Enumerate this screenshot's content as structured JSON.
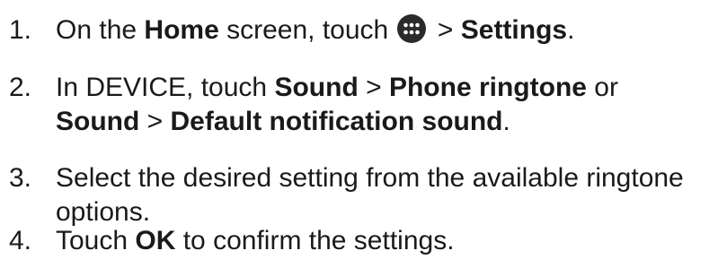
{
  "steps": [
    {
      "number": "1.",
      "pre": "On the ",
      "b1": "Home",
      "mid": " screen, touch ",
      "sep": " > ",
      "b2": "Settings",
      "end": ".",
      "icon": "apps-grid-icon"
    },
    {
      "number": "2.",
      "pre": "In DEVICE, touch ",
      "b1": "Sound",
      "sep1": " > ",
      "b2": "Phone ringtone",
      "mid": " or",
      "b3": "Sound",
      "sep2": " > ",
      "b4": "Default notification sound",
      "end": "."
    },
    {
      "number": "3.",
      "text": "Select the desired setting from the available ringtone options."
    },
    {
      "number": "4.",
      "pre": "Touch ",
      "b1": "OK",
      "post": " to confirm the settings."
    }
  ],
  "colors": {
    "text": "#1a1a1a",
    "icon_bg": "#2b2b2b"
  }
}
